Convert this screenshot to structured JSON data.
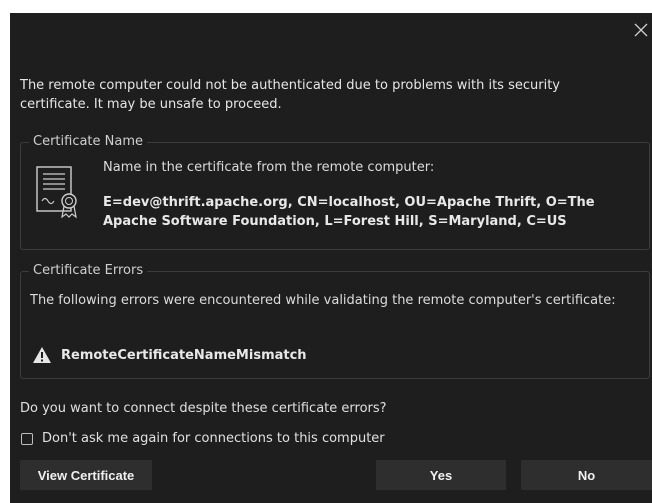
{
  "dialog": {
    "intro_text": "The remote computer could not be authenticated due to problems with its security certificate. It may be unsafe to proceed.",
    "certificate_name": {
      "title": "Certificate Name",
      "label": "Name in the certificate from the remote computer:",
      "value": "E=dev@thrift.apache.org, CN=localhost, OU=Apache Thrift, O=The Apache Software Foundation, L=Forest Hill, S=Maryland, C=US"
    },
    "certificate_errors": {
      "title": "Certificate Errors",
      "description": "The following errors were encountered while validating the remote computer's certificate:",
      "errors": [
        "RemoteCertificateNameMismatch"
      ]
    },
    "question": "Do you want to connect despite these certificate errors?",
    "dont_ask_label": "Don't ask me again for connections to this computer",
    "dont_ask_checked": false,
    "buttons": {
      "view_certificate": "View Certificate",
      "yes": "Yes",
      "no": "No"
    },
    "icons": {
      "close": "close-icon",
      "certificate": "certificate-icon",
      "warning": "warning-icon"
    },
    "colors": {
      "background": "#1e1e1e",
      "text": "#e6e6e6",
      "button": "#2e2e2e",
      "border": "#3c3c3c"
    }
  }
}
